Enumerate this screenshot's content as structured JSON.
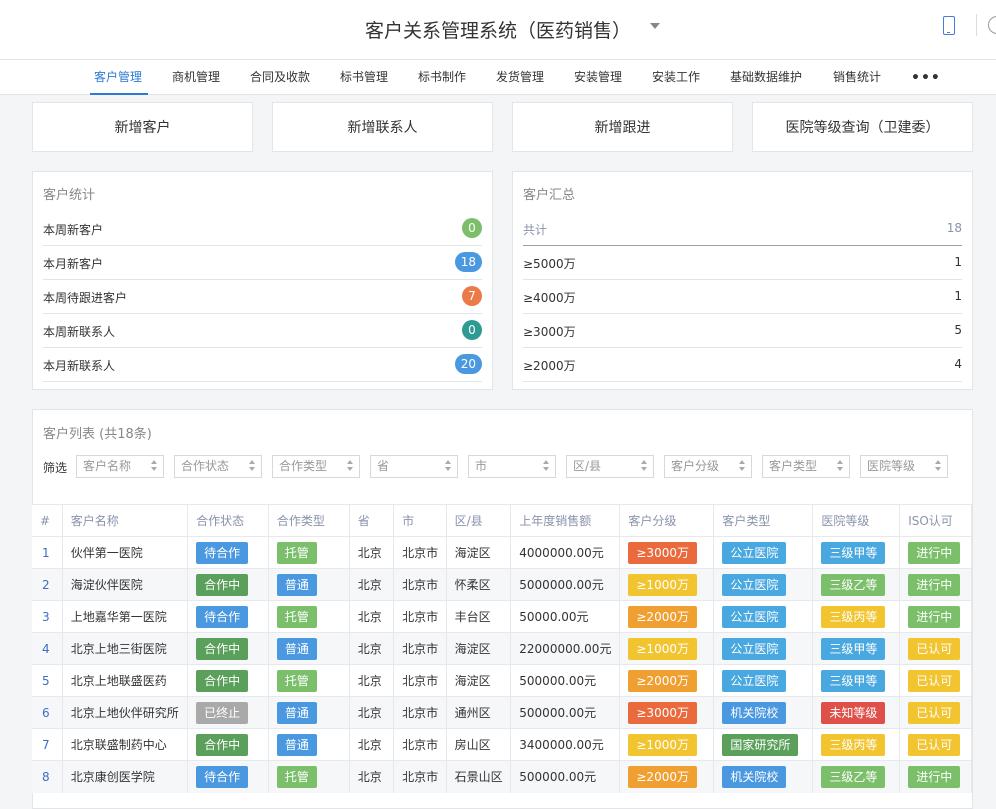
{
  "header": {
    "title": "客户关系管理系统（医药销售）"
  },
  "nav": {
    "items": [
      "客户管理",
      "商机管理",
      "合同及收款",
      "标书管理",
      "标书制作",
      "发货管理",
      "安装管理",
      "安装工作",
      "基础数据维护",
      "销售统计"
    ],
    "more": "•••"
  },
  "actions": [
    "新增客户",
    "新增联系人",
    "新增跟进",
    "医院等级查询（卫建委）"
  ],
  "stats": {
    "title": "客户统计",
    "rows": [
      {
        "label": "本周新客户",
        "value": "0",
        "color": "#7bbf6a"
      },
      {
        "label": "本月新客户",
        "value": "18",
        "color": "#4a98e0"
      },
      {
        "label": "本周待跟进客户",
        "value": "7",
        "color": "#ea7b49"
      },
      {
        "label": "本周新联系人",
        "value": "0",
        "color": "#2e9a94"
      },
      {
        "label": "本月新联系人",
        "value": "20",
        "color": "#4a98e0"
      }
    ]
  },
  "summary": {
    "title": "客户汇总",
    "rows": [
      {
        "label": "共计",
        "value": "18"
      },
      {
        "label": "≥5000万",
        "value": "1"
      },
      {
        "label": "≥4000万",
        "value": "1"
      },
      {
        "label": "≥3000万",
        "value": "5"
      },
      {
        "label": "≥2000万",
        "value": "4"
      }
    ]
  },
  "list": {
    "title": "客户列表 (共18条)",
    "filter_label": "筛选",
    "filters": [
      "客户名称",
      "合作状态",
      "合作类型",
      "省",
      "市",
      "区/县",
      "客户分级",
      "客户类型",
      "医院等级"
    ],
    "columns": [
      "#",
      "客户名称",
      "合作状态",
      "合作类型",
      "省",
      "市",
      "区/县",
      "上年度销售额",
      "客户分级",
      "客户类型",
      "医院等级",
      "ISO认可"
    ],
    "rows": [
      [
        "1",
        "伙伴第一医院",
        "待合作",
        "托管",
        "北京",
        "北京市",
        "海淀区",
        "4000000.00元",
        "≥3000万",
        "公立医院",
        "三级甲等",
        "进行中"
      ],
      [
        "2",
        "海淀伙伴医院",
        "合作中",
        "普通",
        "北京",
        "北京市",
        "怀柔区",
        "5000000.00元",
        "≥1000万",
        "公立医院",
        "三级乙等",
        "进行中"
      ],
      [
        "3",
        "上地嘉华第一医院",
        "待合作",
        "托管",
        "北京",
        "北京市",
        "丰台区",
        "50000.00元",
        "≥2000万",
        "公立医院",
        "三级丙等",
        "进行中"
      ],
      [
        "4",
        "北京上地三街医院",
        "合作中",
        "普通",
        "北京",
        "北京市",
        "海淀区",
        "22000000.00元",
        "≥1000万",
        "公立医院",
        "三级甲等",
        "已认可"
      ],
      [
        "5",
        "北京上地联盛医药",
        "合作中",
        "托管",
        "北京",
        "北京市",
        "海淀区",
        "500000.00元",
        "≥2000万",
        "公立医院",
        "三级甲等",
        "已认可"
      ],
      [
        "6",
        "北京上地伙伴研究所",
        "已终止",
        "普通",
        "北京",
        "北京市",
        "通州区",
        "500000.00元",
        "≥3000万",
        "机关院校",
        "未知等级",
        "已认可"
      ],
      [
        "7",
        "北京联盛制药中心",
        "合作中",
        "普通",
        "北京",
        "北京市",
        "房山区",
        "3400000.00元",
        "≥1000万",
        "国家研究所",
        "三级丙等",
        "已认可"
      ],
      [
        "8",
        "北京康创医学院",
        "待合作",
        "托管",
        "北京",
        "北京市",
        "石景山区",
        "500000.00元",
        "≥2000万",
        "机关院校",
        "三级乙等",
        "进行中"
      ]
    ]
  },
  "tag_colors": {
    "待合作": "#4a98e0",
    "合作中": "#5aa05a",
    "已终止": "#a9a9a9",
    "托管": "#7bbf6a",
    "普通": "#4a98e0",
    "≥3000万": "#ea6a3d",
    "≥1000万": "#f2c430",
    "≥2000万": "#f0a030",
    "公立医院": "#4aa8e0",
    "机关院校": "#4a98e0",
    "国家研究所": "#5aa05a",
    "三级甲等": "#4aa8e0",
    "三级乙等": "#7bbf6a",
    "三级丙等": "#f2c430",
    "未知等级": "#e0504a",
    "进行中": "#7bbf6a",
    "已认可": "#f2c430"
  }
}
